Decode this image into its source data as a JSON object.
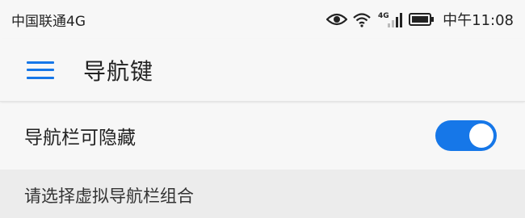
{
  "status_bar": {
    "carrier": "中国联通4G",
    "network_badge": "4G",
    "time": "中午11:08",
    "icons": [
      "eye-icon",
      "wifi-icon",
      "signal-icon",
      "battery-icon"
    ]
  },
  "app_bar": {
    "menu_icon": "hamburger-menu-icon",
    "title": "导航键"
  },
  "settings": {
    "hide_nav_bar": {
      "label": "导航栏可隐藏",
      "enabled": true
    }
  },
  "section": {
    "header": "请选择虚拟导航栏组合"
  },
  "colors": {
    "accent": "#1677e8",
    "background": "#f7f7f7",
    "section_bg": "#ececec"
  }
}
